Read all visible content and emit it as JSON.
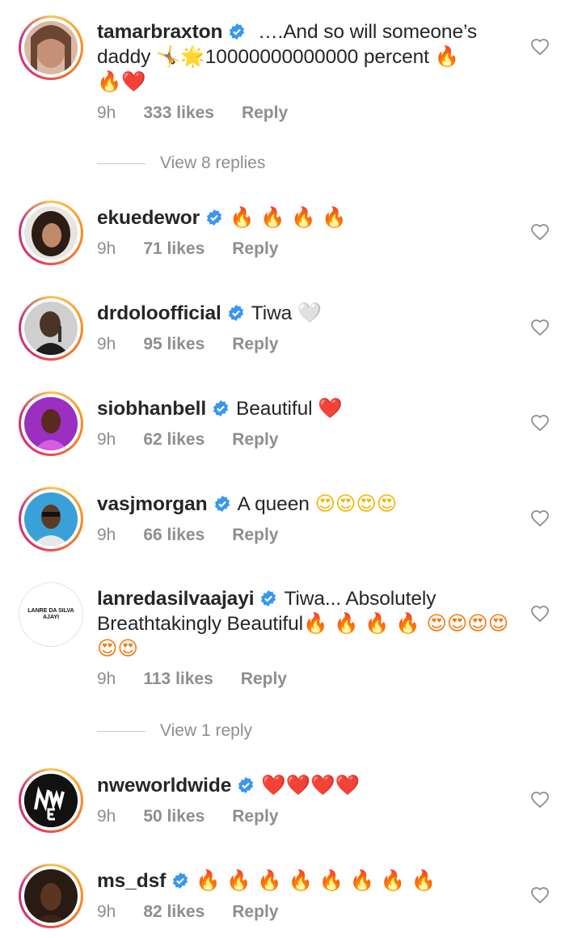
{
  "comments": [
    {
      "username": "tamarbraxton",
      "text_pre": " ….And so will someone’s daddy ",
      "text_mid": " 🌟",
      "text_num": "10000000000000 percent ",
      "tail": "🔥🔥❤️",
      "time": "9h",
      "likes": "333 likes",
      "reply": "Reply"
    },
    {
      "username": "ekuedewor",
      "emojis": "🔥 🔥 🔥 🔥",
      "time": "9h",
      "likes": "71 likes",
      "reply": "Reply"
    },
    {
      "username": "drdoloofficial",
      "text": "Tiwa",
      "emojis": "🤍",
      "time": "9h",
      "likes": "95 likes",
      "reply": "Reply"
    },
    {
      "username": "siobhanbell",
      "text": "Beautiful",
      "emojis": "❤️",
      "time": "9h",
      "likes": "62 likes",
      "reply": "Reply"
    },
    {
      "username": "vasjmorgan",
      "text": "A queen",
      "emojis": "😍😍😍😍",
      "time": "9h",
      "likes": "66 likes",
      "reply": "Reply"
    },
    {
      "username": "lanredasilvaajayi",
      "text": "Tiwa... Absolutely Breathtakingly Beautiful",
      "emojis": "🔥 🔥 🔥 🔥 😍😍😍😍😍😍",
      "time": "9h",
      "likes": "113 likes",
      "reply": "Reply",
      "avatar_text": "LANRE DA SILVA AJAYI"
    },
    {
      "username": "nweworldwide",
      "emojis": "❤️❤️❤️❤️",
      "time": "9h",
      "likes": "50 likes",
      "reply": "Reply"
    },
    {
      "username": "ms_dsf",
      "emojis": "🔥 🔥 🔥 🔥 🔥 🔥 🔥 🔥",
      "time": "9h",
      "likes": "82 likes",
      "reply": "Reply"
    }
  ],
  "view_replies_1": "View 8 replies",
  "view_replies_2": "View 1 reply",
  "icons": {
    "verified": "verified-badge-icon",
    "like": "heart-outline-icon"
  },
  "colors": {
    "verified": "#3897f0",
    "muted": "#8e8e8e",
    "text": "#262626"
  }
}
